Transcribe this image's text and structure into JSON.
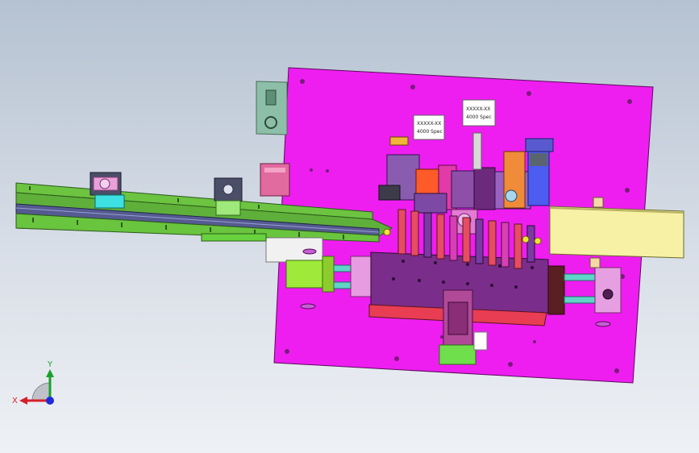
{
  "viewport": {
    "background": "cad-gradient"
  },
  "part_labels": {
    "label_1": [
      "XXXXX-XX",
      "4000 Spec"
    ],
    "label_2": [
      "XXXXX-XX",
      "4000 Spec"
    ]
  },
  "triad": {
    "x_label": "X",
    "y_label": "Y",
    "colors": {
      "x": "#d4202a",
      "y": "#1aa02c",
      "z": "#1d2bd8"
    }
  },
  "colors": {
    "plate": "#ee1ef0",
    "conveyor_green": "#6cc441",
    "chute_yellow": "#f6f1a4",
    "slide_block": "#7a2d8a"
  }
}
